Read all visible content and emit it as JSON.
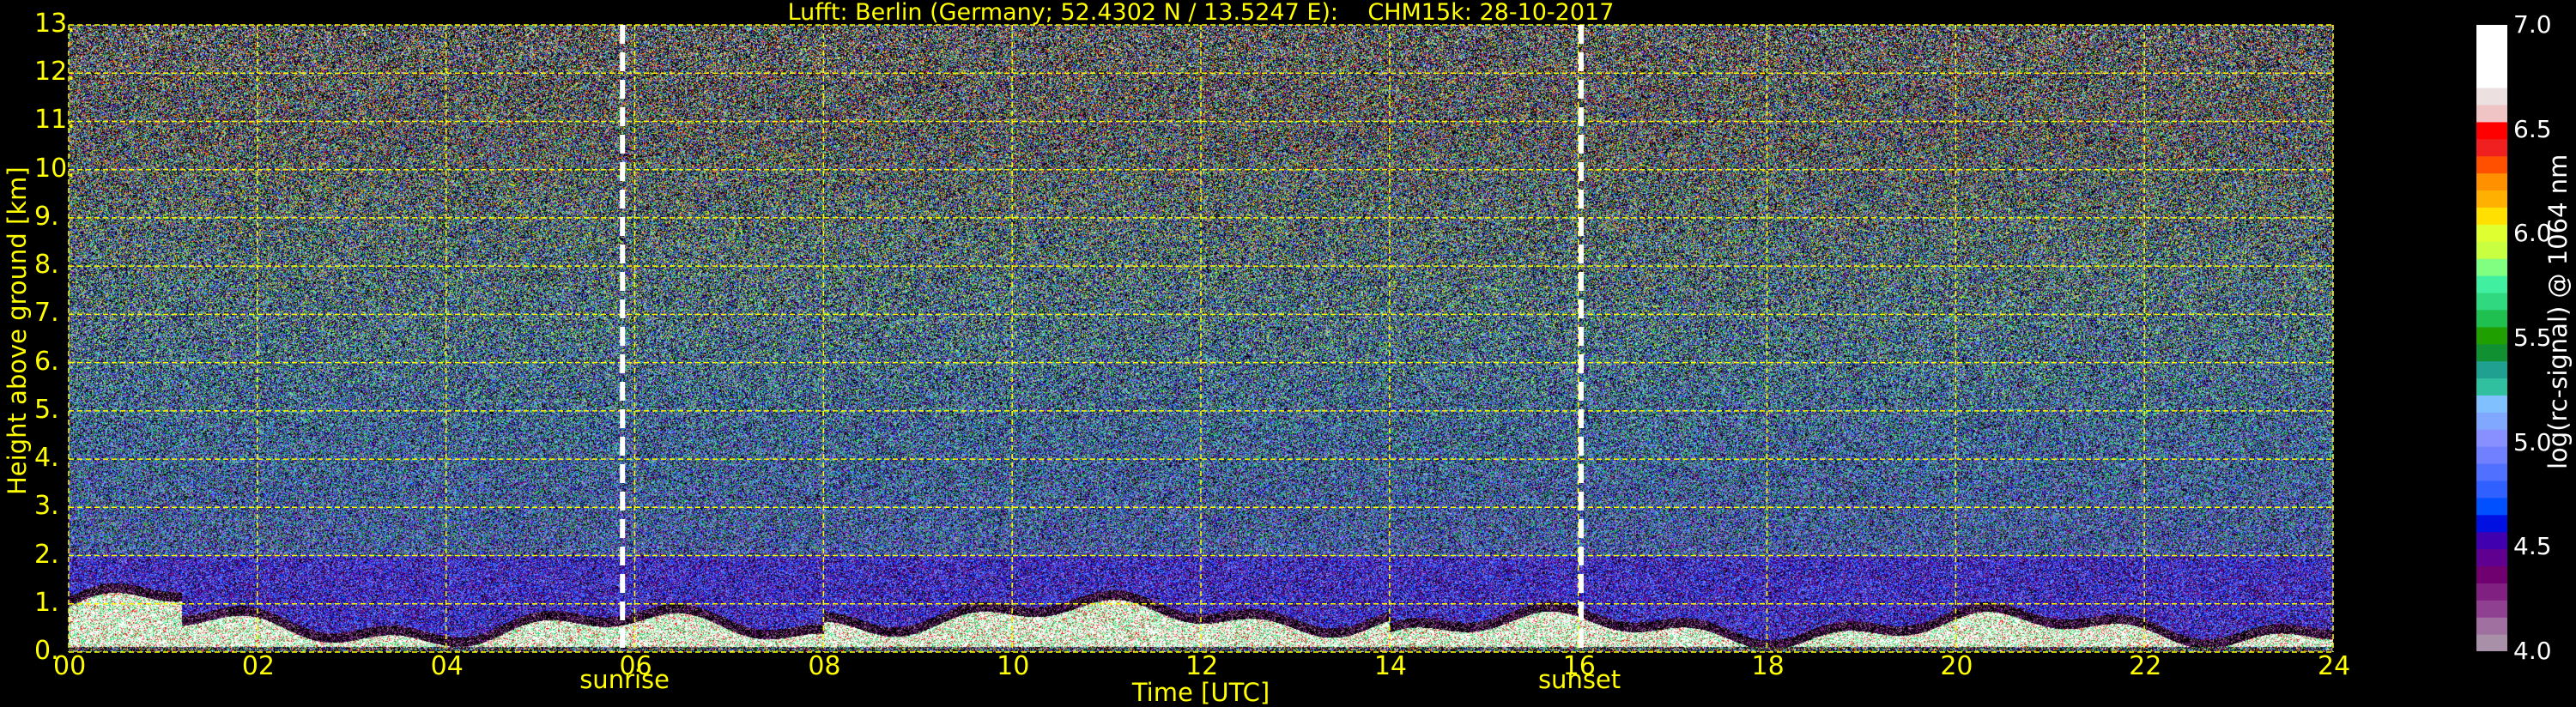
{
  "chart_data": {
    "type": "heatmap",
    "title": "Lufft: Berlin (Germany; 52.4302 N / 13.5247 E):    CHM15k: 28-10-2017",
    "xlabel": "Time [UTC]",
    "ylabel": "Height above ground [km]",
    "xlim": [
      0,
      24
    ],
    "ylim": [
      0,
      13
    ],
    "x_ticks": [
      "00",
      "02",
      "04",
      "06",
      "08",
      "10",
      "12",
      "14",
      "16",
      "18",
      "20",
      "22",
      "24"
    ],
    "x_tick_values": [
      0,
      2,
      4,
      6,
      8,
      10,
      12,
      14,
      16,
      18,
      20,
      22,
      24
    ],
    "y_ticks": [
      "0.",
      "1.",
      "2.",
      "3.",
      "4.",
      "5.",
      "6.",
      "7.",
      "8.",
      "9.",
      "10.",
      "11.",
      "12.",
      "13."
    ],
    "y_tick_values": [
      0,
      1,
      2,
      3,
      4,
      5,
      6,
      7,
      8,
      9,
      10,
      11,
      12,
      13
    ],
    "grid": true,
    "annotations": [
      {
        "label": "sunrise",
        "time_utc": 5.87
      },
      {
        "label": "sunset",
        "time_utc": 16.03
      }
    ],
    "colorbar": {
      "label": "log(rc-signal) @ 1064 nm",
      "range": [
        4.0,
        7.0
      ],
      "ticks": [
        "7.0",
        "6.5",
        "6.0",
        "5.5",
        "5.0",
        "4.5",
        "4.0"
      ],
      "tick_values": [
        7.0,
        6.5,
        6.0,
        5.5,
        5.0,
        4.5,
        4.0
      ],
      "colors_low_to_high": [
        "#a890a8",
        "#a070a0",
        "#904090",
        "#802080",
        "#700070",
        "#600090",
        "#4000b0",
        "#0010e0",
        "#0050ff",
        "#3060ff",
        "#5070ff",
        "#7080ff",
        "#8890ff",
        "#80a8ff",
        "#80c0ff",
        "#30c0a0",
        "#20a090",
        "#109030",
        "#20a000",
        "#20c050",
        "#30d880",
        "#40f0a0",
        "#80ff80",
        "#c8ff40",
        "#e0ff30",
        "#ffe000",
        "#ffb000",
        "#ff9000",
        "#ff5000",
        "#f02020",
        "#ff0000",
        "#f0c4c4",
        "#ece0e0",
        "#ffffff"
      ]
    }
  }
}
